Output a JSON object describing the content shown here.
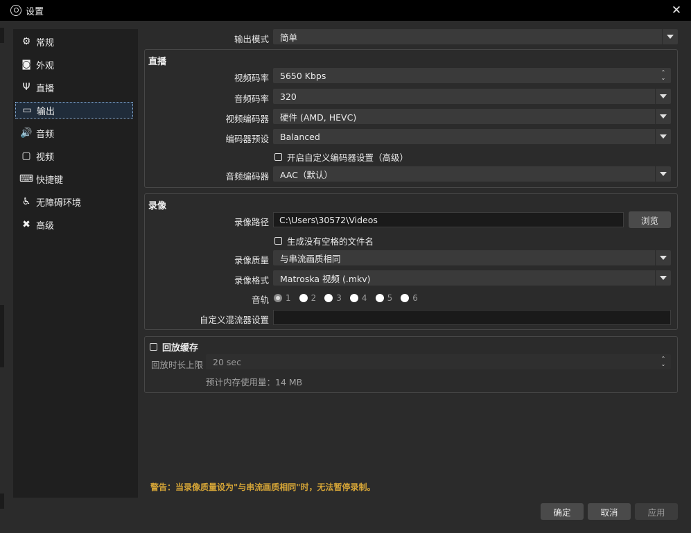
{
  "window": {
    "title": "设置",
    "close_glyph": "✕",
    "icon": "obs-logo-icon"
  },
  "sidebar": {
    "items": [
      {
        "label": "常规",
        "icon": "gear-icon",
        "glyph": "⚙"
      },
      {
        "label": "外观",
        "icon": "appearance-icon",
        "glyph": "◙"
      },
      {
        "label": "直播",
        "icon": "antenna-icon",
        "glyph": "Ψ"
      },
      {
        "label": "输出",
        "icon": "output-icon",
        "glyph": "▭",
        "active": true
      },
      {
        "label": "音频",
        "icon": "speaker-icon",
        "glyph": "🔊"
      },
      {
        "label": "视频",
        "icon": "monitor-icon",
        "glyph": "▢"
      },
      {
        "label": "快捷键",
        "icon": "keyboard-icon",
        "glyph": "⌨"
      },
      {
        "label": "无障碍环境",
        "icon": "accessibility-icon",
        "glyph": "♿"
      },
      {
        "label": "高级",
        "icon": "tools-icon",
        "glyph": "✖"
      }
    ]
  },
  "output_mode": {
    "label": "输出模式",
    "value": "简单"
  },
  "streaming": {
    "title": "直播",
    "video_bitrate": {
      "label": "视频码率",
      "value": "5650 Kbps"
    },
    "audio_bitrate": {
      "label": "音频码率",
      "value": "320"
    },
    "video_encoder": {
      "label": "视频编码器",
      "value": "硬件 (AMD, HEVC)"
    },
    "encoder_preset": {
      "label": "编码器预设",
      "value": "Balanced"
    },
    "custom_encoder_checkbox": "开启自定义编码器设置（高级）",
    "audio_encoder": {
      "label": "音频编码器",
      "value": "AAC（默认）"
    }
  },
  "recording": {
    "title": "录像",
    "path": {
      "label": "录像路径",
      "value": "C:\\Users\\30572\\Videos",
      "browse": "浏览"
    },
    "no_space_checkbox": "生成没有空格的文件名",
    "quality": {
      "label": "录像质量",
      "value": "与串流画质相同"
    },
    "format": {
      "label": "录像格式",
      "value": "Matroska 视频 (.mkv)"
    },
    "tracks": {
      "label": "音轨",
      "options": [
        "1",
        "2",
        "3",
        "4",
        "5",
        "6"
      ],
      "selected": "1"
    },
    "muxer": {
      "label": "自定义混流器设置",
      "value": ""
    }
  },
  "replay_buffer": {
    "title": "回放缓存",
    "max_time": {
      "label": "回放时长上限",
      "value": "20 sec"
    },
    "memory_usage": "预计内存使用量：14 MB"
  },
  "warning": "警告：当录像质量设为\"与串流画质相同\"时，无法暂停录制。",
  "buttons": {
    "ok": "确定",
    "cancel": "取消",
    "apply": "应用"
  },
  "colors": {
    "warning": "#d4a437",
    "active_nav": "#202c3a"
  }
}
